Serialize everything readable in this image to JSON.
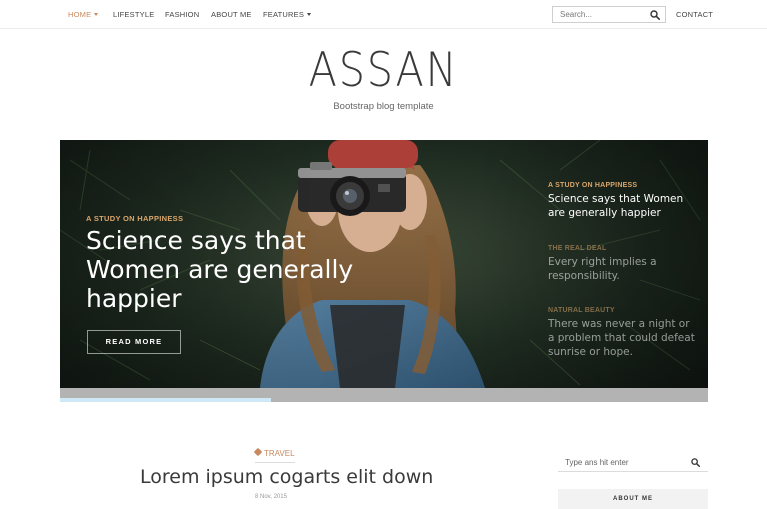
{
  "nav": {
    "items": [
      {
        "label": "HOME",
        "has_dropdown": true,
        "active": true
      },
      {
        "label": "LIFESTYLE",
        "has_dropdown": false,
        "active": false
      },
      {
        "label": "FASHION",
        "has_dropdown": false,
        "active": false
      },
      {
        "label": "ABOUT ME",
        "has_dropdown": false,
        "active": false
      },
      {
        "label": "FEATURES",
        "has_dropdown": true,
        "active": false
      }
    ],
    "search_placeholder": "Search...",
    "search_icon": "search-icon",
    "contact_label": "CONTACT"
  },
  "brand": {
    "logo": "ASSAN",
    "tagline": "Bootstrap blog template"
  },
  "hero": {
    "category": "A STUDY ON HAPPINESS",
    "title": "Science says that Women are generally happier",
    "button_label": "READ MORE",
    "side_items": [
      {
        "category": "A STUDY ON HAPPINESS",
        "title": "Science says that Women are generally happier",
        "active": true
      },
      {
        "category": "THE REAL DEAL",
        "title": "Every right implies a responsibility.",
        "active": false
      },
      {
        "category": "NATURAL BEAUTY",
        "title": "There was never a night or a problem that could defeat sunrise or hope.",
        "active": false
      }
    ],
    "slider_progress": 0.325
  },
  "post": {
    "tag": "TRAVEL",
    "tag_icon": "tag-icon",
    "title": "Lorem ipsum cogarts elit down",
    "date": "8 Nov, 2015"
  },
  "sidebar": {
    "search_placeholder": "Type ans hit enter",
    "search_icon": "search-icon",
    "about_label": "ABOUT ME"
  },
  "colors": {
    "accent": "#c8895f",
    "hero_category": "#d9a66b",
    "slider_track": "#b3b3b3",
    "slider_fill": "#cfe8f5"
  }
}
